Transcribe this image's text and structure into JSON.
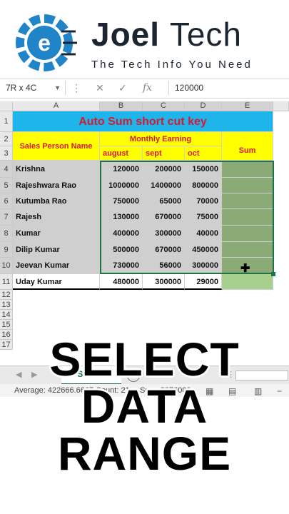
{
  "brand": {
    "name_bold": "Joel",
    "name_light": "Tech",
    "tagline": "The Tech Info You Need",
    "logo_letter": "e",
    "colors": {
      "logo_blue": "#1f84c8",
      "logo_dark": "#1c2430"
    }
  },
  "formula_bar": {
    "name_box": "7R x 4C",
    "cancel_icon": "close-icon",
    "enter_icon": "check-icon",
    "function_label": "fx",
    "value": "120000"
  },
  "columns": [
    "A",
    "B",
    "C",
    "D",
    "E"
  ],
  "rows": [
    "1",
    "2",
    "3",
    "4",
    "5",
    "6",
    "7",
    "8",
    "9",
    "10",
    "11",
    "12",
    "13",
    "14",
    "15",
    "16",
    "17"
  ],
  "sheet": {
    "title": "Auto Sum short cut key",
    "header_sales": "Sales Person Name",
    "header_monthly": "Monthly Earning",
    "header_sum": "Sum",
    "months": [
      "august",
      "sept",
      "oct"
    ],
    "data": [
      {
        "name": "Krishna",
        "values": [
          "120000",
          "200000",
          "150000"
        ]
      },
      {
        "name": "Rajeshwara Rao",
        "values": [
          "1000000",
          "1400000",
          "800000"
        ]
      },
      {
        "name": "Kutumba Rao",
        "values": [
          "750000",
          "65000",
          "70000"
        ]
      },
      {
        "name": "Rajesh",
        "values": [
          "130000",
          "670000",
          "75000"
        ]
      },
      {
        "name": "Kumar",
        "values": [
          "400000",
          "300000",
          "40000"
        ]
      },
      {
        "name": "Dilip Kumar",
        "values": [
          "500000",
          "670000",
          "450000"
        ]
      },
      {
        "name": "Jeevan Kumar",
        "values": [
          "730000",
          "56000",
          "300000"
        ]
      },
      {
        "name": "Uday Kumar",
        "values": [
          "480000",
          "300000",
          "29000"
        ]
      }
    ]
  },
  "sheet_tabs": {
    "active": "Sheet1",
    "add_icon": "plus-icon"
  },
  "status": {
    "average": "Average: 422666.6667",
    "count": "Count: 21",
    "sum": "Sum: 8876000"
  },
  "caption": [
    "SELECT",
    "DATA",
    "RANGE"
  ]
}
